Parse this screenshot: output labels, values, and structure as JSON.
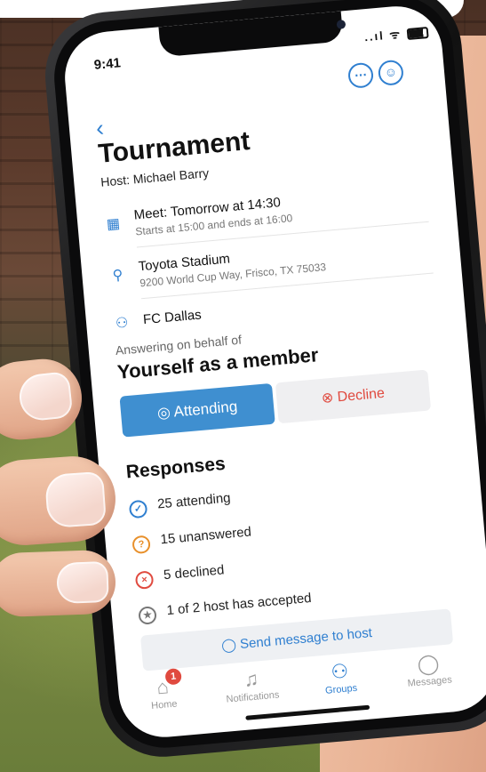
{
  "status": {
    "time": "9:41",
    "signal": "..ıl ᯤ"
  },
  "header": {
    "more_icon": "ellipsis-icon",
    "profile_icon": "user-settings-icon",
    "back_icon": "chevron-left-icon"
  },
  "event": {
    "title": "Tournament",
    "host": "Host: Michael Barry",
    "meet": {
      "title": "Meet: Tomorrow at 14:30",
      "subtitle": "Starts at 15:00 and ends at 16:00"
    },
    "location": {
      "title": "Toyota Stadium",
      "subtitle": "9200 World Cup Way, Frisco, TX 75033"
    },
    "team": {
      "title": "FC Dallas"
    }
  },
  "rsvp": {
    "on_behalf_label": "Answering on behalf of",
    "member_label": "Yourself as a member",
    "attending_label": "Attending",
    "decline_label": "Decline"
  },
  "responses": {
    "title": "Responses",
    "items": [
      {
        "label": "25 attending",
        "icon": "check-circle-icon",
        "color": "#2f7fd0"
      },
      {
        "label": "15 unanswered",
        "icon": "question-circle-icon",
        "color": "#e8902b"
      },
      {
        "label": "5 declined",
        "icon": "x-circle-icon",
        "color": "#e04a3f"
      },
      {
        "label": "1 of 2 host has accepted",
        "icon": "star-circle-icon",
        "color": "#777777"
      }
    ],
    "send_label": "Send message to host"
  },
  "tabs": [
    {
      "label": "Home",
      "icon": "home-icon",
      "badge": "1"
    },
    {
      "label": "Notifications",
      "icon": "bell-icon"
    },
    {
      "label": "Groups",
      "icon": "groups-icon",
      "active": true
    },
    {
      "label": "Messages",
      "icon": "chat-bubble-icon"
    }
  ],
  "colors": {
    "accent": "#2f7fd0",
    "attend_button": "#3f8fd0",
    "decline_text": "#e04a3f",
    "badge": "#e04a3f"
  }
}
